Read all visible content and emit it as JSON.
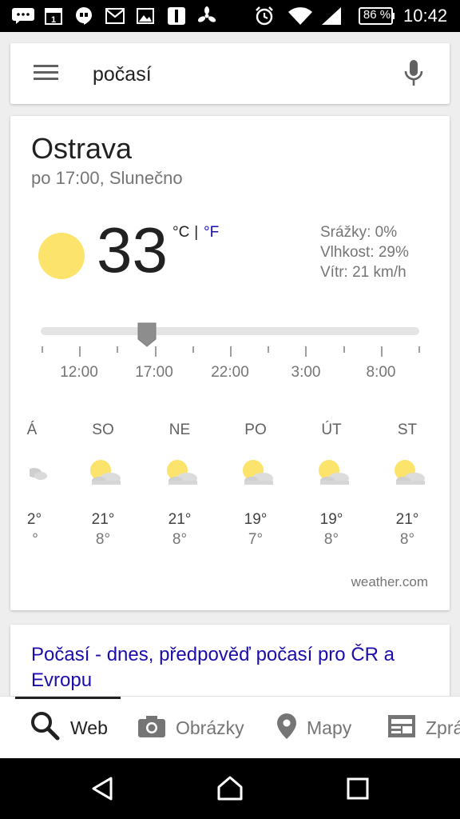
{
  "statusbar": {
    "battery": "86 %",
    "time": "10:42",
    "icons": [
      "message-icon",
      "calendar-icon",
      "hangouts-icon",
      "gmail-icon",
      "gallery-icon",
      "app-icon",
      "fan-icon",
      "alarm-icon",
      "wifi-icon",
      "signal-icon",
      "battery-icon"
    ],
    "calendar_day": "1"
  },
  "search": {
    "query": "počasí",
    "icons": [
      "menu-icon",
      "mic-icon"
    ]
  },
  "weather": {
    "city": "Ostrava",
    "subtitle": "po 17:00, Slunečno",
    "temperature": "33",
    "unit_c": "°C",
    "unit_sep": " | ",
    "unit_f": "°F",
    "precipitation": "Srážky: 0%",
    "humidity": "Vlhkost: 29%",
    "wind": "Vítr: 21 km/h",
    "condition_icon": "sun-icon",
    "accent_color": "#fce36b",
    "slider_fraction": 0.28,
    "timeline": [
      "12:00",
      "17:00",
      "22:00",
      "3:00",
      "8:00"
    ],
    "forecast": [
      {
        "day": "Á",
        "hi": "2°",
        "lo": "°",
        "icon": "cloud-icon"
      },
      {
        "day": "SO",
        "hi": "21°",
        "lo": "8°",
        "icon": "partly-sunny-icon"
      },
      {
        "day": "NE",
        "hi": "21°",
        "lo": "8°",
        "icon": "partly-sunny-icon"
      },
      {
        "day": "PO",
        "hi": "19°",
        "lo": "7°",
        "icon": "partly-sunny-icon"
      },
      {
        "day": "ÚT",
        "hi": "19°",
        "lo": "8°",
        "icon": "partly-sunny-icon"
      },
      {
        "day": "ST",
        "hi": "21°",
        "lo": "8°",
        "icon": "partly-sunny-icon"
      }
    ],
    "source": "weather.com"
  },
  "result": {
    "title": "Počasí - dnes, předpověď počasí pro ČR a Evropu",
    "link_color": "#1a0dab"
  },
  "tabs": [
    {
      "label": "Web",
      "icon": "search-icon",
      "active": true
    },
    {
      "label": "Obrázky",
      "icon": "camera-icon",
      "active": false
    },
    {
      "label": "Mapy",
      "icon": "map-pin-icon",
      "active": false
    },
    {
      "label": "Zprávy",
      "icon": "newspaper-icon",
      "active": false
    }
  ],
  "navbar": {
    "icons": [
      "back-icon",
      "home-icon",
      "recents-icon"
    ]
  }
}
